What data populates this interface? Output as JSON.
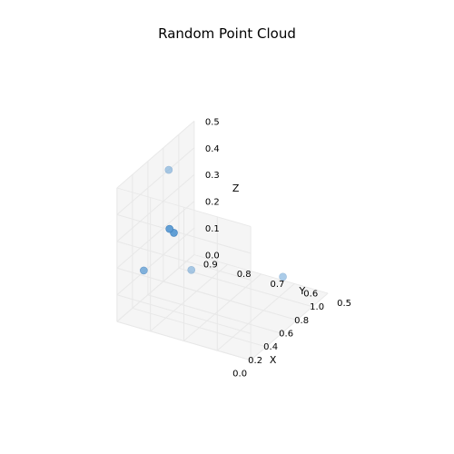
{
  "chart_data": {
    "type": "scatter",
    "title": "Random Point Cloud",
    "xlabel": "X",
    "ylabel": "Y",
    "zlabel": "Z",
    "xlim": [
      0.0,
      1.0
    ],
    "ylim": [
      0.5,
      0.9
    ],
    "zlim": [
      0.0,
      0.5
    ],
    "xticks": [
      0.0,
      0.2,
      0.4,
      0.6,
      0.8,
      1.0
    ],
    "yticks": [
      0.5,
      0.6,
      0.7,
      0.8,
      0.9
    ],
    "zticks": [
      0.0,
      0.1,
      0.2,
      0.3,
      0.4,
      0.5
    ],
    "points": [
      {
        "x": 0.0,
        "y": 0.82,
        "z": 0.22,
        "alpha": 0.75
      },
      {
        "x": 0.4,
        "y": 0.77,
        "z": 0.14,
        "alpha": 0.5
      },
      {
        "x": 0.52,
        "y": 0.85,
        "z": 0.22,
        "alpha": 0.95
      },
      {
        "x": 0.55,
        "y": 0.87,
        "z": 0.22,
        "alpha": 0.95
      },
      {
        "x": 0.67,
        "y": 0.9,
        "z": 0.4,
        "alpha": 0.5
      },
      {
        "x": 0.98,
        "y": 0.63,
        "z": 0.02,
        "alpha": 0.5
      }
    ]
  }
}
